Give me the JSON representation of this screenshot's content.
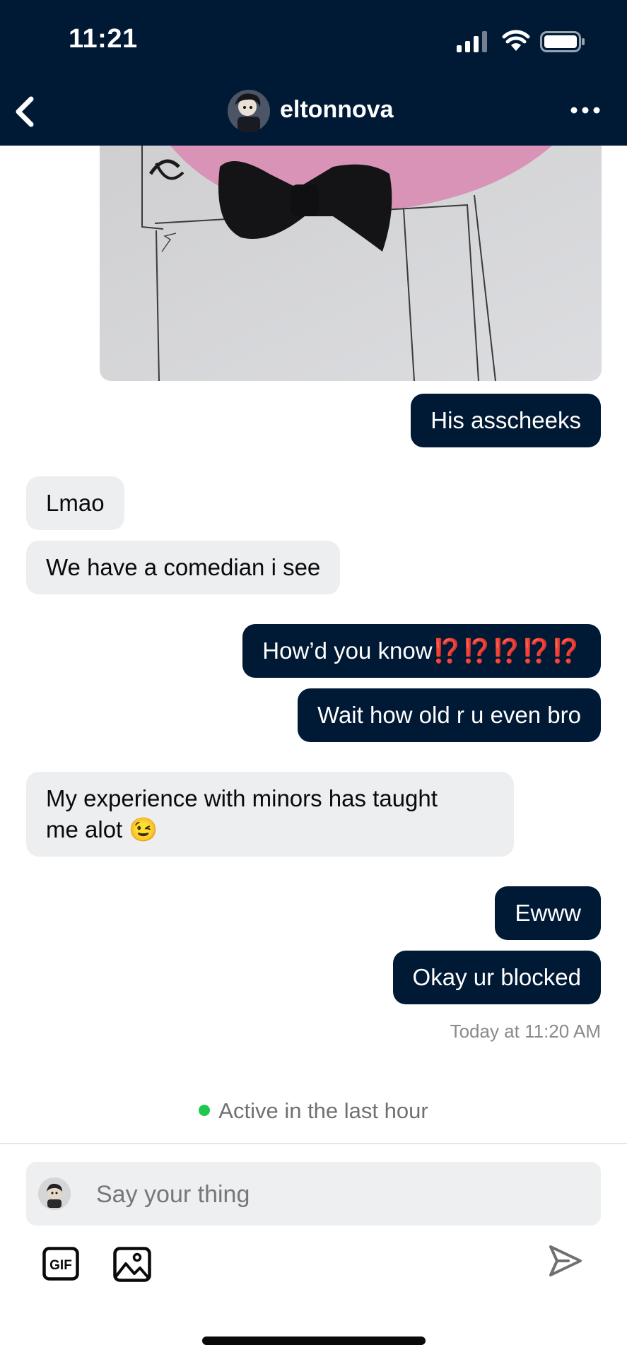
{
  "status_bar": {
    "time": "11:21"
  },
  "header": {
    "username": "eltonnova"
  },
  "messages": [
    {
      "sender": "me",
      "text": "His asscheeks"
    },
    {
      "sender": "them",
      "text": "Lmao"
    },
    {
      "sender": "them",
      "text": "We have a comedian i see"
    },
    {
      "sender": "me",
      "text": "How’d you know",
      "emoji": "⁉️⁉️⁉️⁉️⁉️"
    },
    {
      "sender": "me",
      "text": "Wait how old r u even bro"
    },
    {
      "sender": "them",
      "text": "My experience with minors has taught",
      "text2": "me alot",
      "emoji": "😉"
    },
    {
      "sender": "me",
      "text": "Ewww"
    },
    {
      "sender": "me",
      "text": "Okay ur blocked"
    }
  ],
  "timestamp": "Today at 11:20 AM",
  "presence": "Active in the last hour",
  "composer": {
    "placeholder": "Say your thing"
  },
  "toolbar": {
    "gif_label": "GIF"
  },
  "colors": {
    "header_bg": "#001935",
    "outgoing_bubble": "#001935",
    "incoming_bubble": "#eceef0",
    "presence_dot": "#1ec850",
    "emoji_red": "#e8381f"
  },
  "icons": [
    "back-chevron-icon",
    "more-dots-icon",
    "gif-icon",
    "image-icon",
    "send-icon"
  ]
}
